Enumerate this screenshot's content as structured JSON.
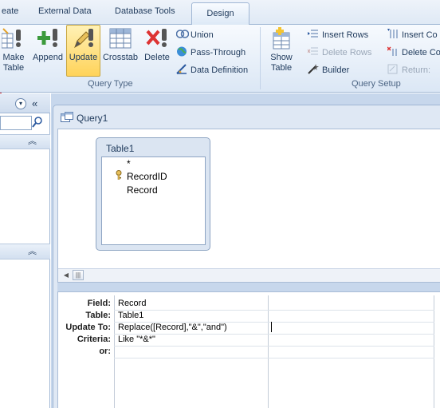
{
  "tabs": [
    "eate",
    "External Data",
    "Database Tools",
    "Design"
  ],
  "ribbon": {
    "query_type_buttons": [
      {
        "label": "Make\nTable",
        "icon": "make-table-icon"
      },
      {
        "label": "Append",
        "icon": "append-icon"
      },
      {
        "label": "Update",
        "icon": "update-pencil-icon"
      },
      {
        "label": "Crosstab",
        "icon": "crosstab-grid-icon"
      },
      {
        "label": "Delete",
        "icon": "delete-x-icon"
      }
    ],
    "query_type_small": [
      "Union",
      "Pass-Through",
      "Data Definition"
    ],
    "query_type_label": "Query Type",
    "show_table_label": "Show\nTable",
    "setup_col1": [
      "Insert Rows",
      "Delete Rows",
      "Builder"
    ],
    "setup_col2": [
      "Insert Co",
      "Delete Co",
      "Return:"
    ],
    "query_setup_label": "Query Setup"
  },
  "document": {
    "title": "Query1",
    "table": {
      "name": "Table1",
      "fields": [
        "*",
        "RecordID",
        "Record"
      ]
    }
  },
  "grid": {
    "row_labels": [
      "Field:",
      "Table:",
      "Update To:",
      "Criteria:",
      "or:"
    ],
    "column1": [
      "Record",
      "Table1",
      "Replace([Record],\"&\",\"and\")",
      "Like \"*&*\"",
      ""
    ]
  },
  "colors": {
    "accent_active": "#ffd35a",
    "ribbon_bg": "#dbe7f5",
    "frame_edge": "#d92c2c"
  }
}
